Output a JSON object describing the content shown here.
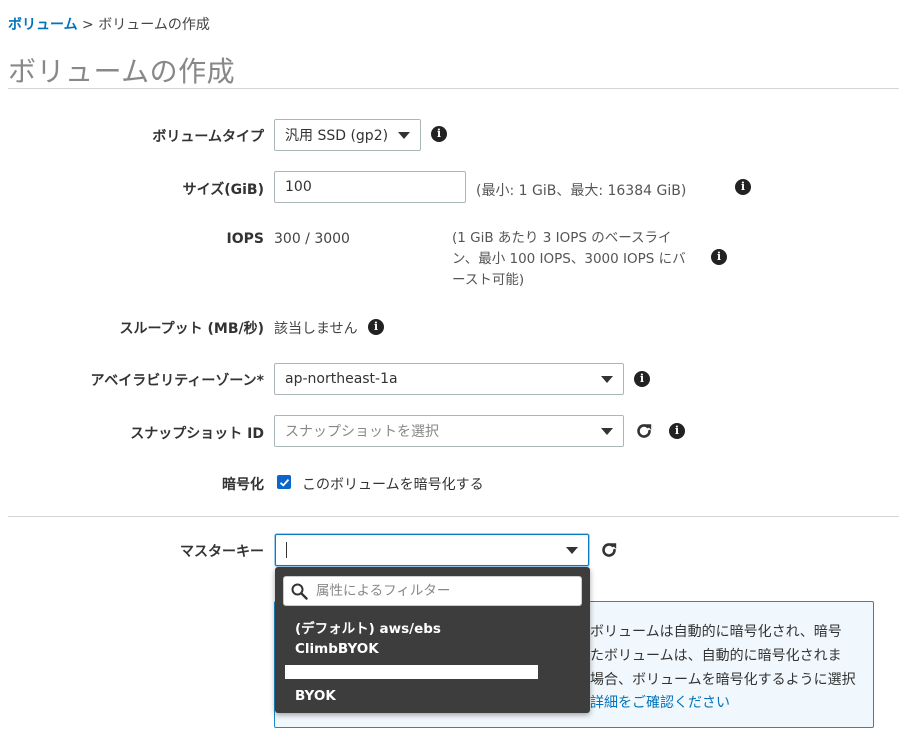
{
  "breadcrumb": {
    "link": "ボリューム",
    "separator": " > ",
    "current": "ボリュームの作成"
  },
  "page_title": "ボリュームの作成",
  "form": {
    "volume_type": {
      "label": "ボリュームタイプ",
      "value": "汎用 SSD (gp2)"
    },
    "size": {
      "label": "サイズ(GiB)",
      "value": "100",
      "hint": "(最小: 1 GiB、最大: 16384 GiB)"
    },
    "iops": {
      "label": "IOPS",
      "value": "300 / 3000",
      "hint_lines": [
        "(1 GiB あたり 3 IOPS のベースライ",
        "ン、最小 100 IOPS、3000 IOPS にバ",
        "ースト可能)"
      ]
    },
    "throughput": {
      "label": "スループット (MB/秒)",
      "value": "該当しません"
    },
    "availability_zone": {
      "label": "アベイラビリティーゾーン*",
      "value": "ap-northeast-1a"
    },
    "snapshot": {
      "label": "スナップショット ID",
      "placeholder": "スナップショットを選択"
    },
    "encryption": {
      "label": "暗号化",
      "checkbox_label": "このボリュームを暗号化する",
      "checked": true
    },
    "master_key": {
      "label": "マスターキー",
      "value": ""
    }
  },
  "dropdown": {
    "filter_placeholder": "属性によるフィルター",
    "options": [
      "(デフォルト) aws/ebs",
      "ClimbBYOK",
      "BYOK"
    ]
  },
  "info_panel": {
    "lines": [
      "ボリュームは自動的に暗号化され、暗号",
      "たボリュームは、自動的に暗号化されま",
      "場合、ボリュームを暗号化するように選択"
    ],
    "link": "詳細をご確認ください"
  },
  "icons": {
    "info": "info-icon",
    "refresh": "refresh-icon",
    "search": "search-icon",
    "caret": "caret-down-icon",
    "check": "checkmark-icon"
  },
  "colors": {
    "link": "#0073bb",
    "accent": "#0a66c8",
    "dropdown_bg": "#3d3d3d",
    "panel_border": "#1f8ac9"
  }
}
